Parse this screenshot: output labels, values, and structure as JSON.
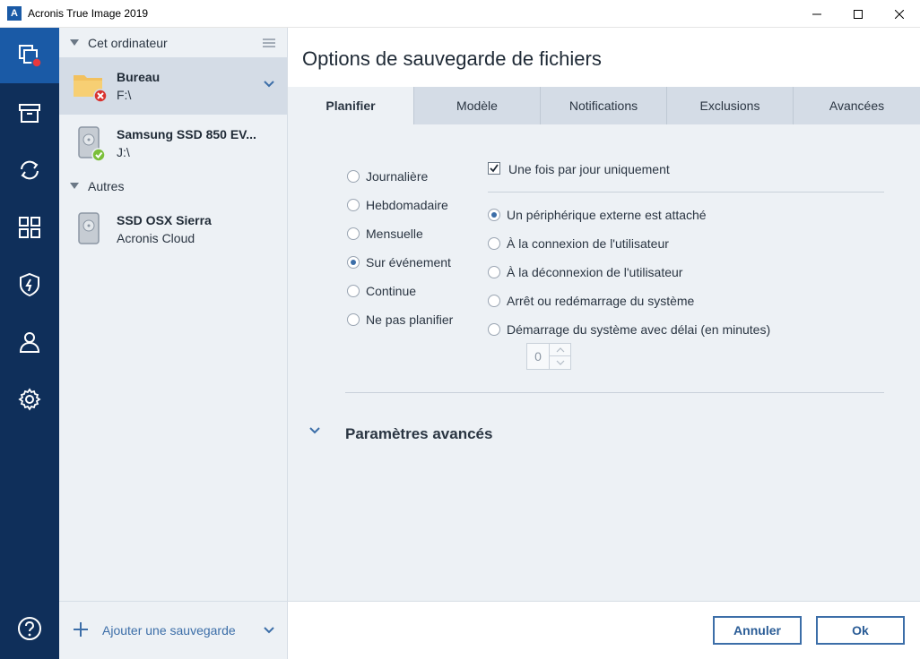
{
  "window": {
    "title": "Acronis True Image 2019",
    "logo_letter": "A",
    "controls": [
      "minimize-icon",
      "maximize-icon",
      "close-icon"
    ]
  },
  "rail": {
    "items": [
      {
        "name": "backup-icon",
        "active": true,
        "badge_color": "#e8383d"
      },
      {
        "name": "archive-icon"
      },
      {
        "name": "sync-icon"
      },
      {
        "name": "tools-icon"
      },
      {
        "name": "shield-icon"
      },
      {
        "name": "account-icon"
      },
      {
        "name": "settings-icon"
      }
    ],
    "help_icon": "help-icon"
  },
  "sidebar": {
    "section_this_computer": "Cet ordinateur",
    "section_others": "Autres",
    "backups": [
      {
        "name": "Bureau",
        "destination": "F:\\",
        "icon": "folder-icon",
        "status": "error",
        "selected": true
      },
      {
        "name": "Samsung SSD 850 EV...",
        "destination": "J:\\",
        "icon": "disk-icon",
        "status": "ok"
      },
      {
        "name": "SSD OSX Sierra",
        "destination": "Acronis Cloud",
        "icon": "disk-icon"
      }
    ],
    "add_backup": "Ajouter une sauvegarde"
  },
  "main": {
    "title": "Options de sauvegarde de fichiers",
    "tabs": [
      "Planifier",
      "Modèle",
      "Notifications",
      "Exclusions",
      "Avancées"
    ],
    "active_tab": 0,
    "schedule_options": [
      "Journalière",
      "Hebdomadaire",
      "Mensuelle",
      "Sur événement",
      "Continue",
      "Ne pas planifier"
    ],
    "schedule_selected": 3,
    "once_per_day": {
      "label": "Une fois par jour uniquement",
      "checked": true
    },
    "event_options": [
      "Un périphérique externe est attaché",
      "À la connexion de l'utilisateur",
      "À la déconnexion de l'utilisateur",
      "Arrêt ou redémarrage du système",
      "Démarrage du système avec délai (en minutes)"
    ],
    "event_selected": 0,
    "delay_minutes": "0",
    "advanced_label": "Paramètres avancés"
  },
  "footer": {
    "cancel": "Annuler",
    "ok": "Ok"
  },
  "colors": {
    "rail_bg": "#0f2f5a",
    "rail_active": "#1a5aa6",
    "accent": "#3c6ea8",
    "error": "#d9322f",
    "success": "#7bbf3a",
    "folder": "#f2c15f"
  }
}
